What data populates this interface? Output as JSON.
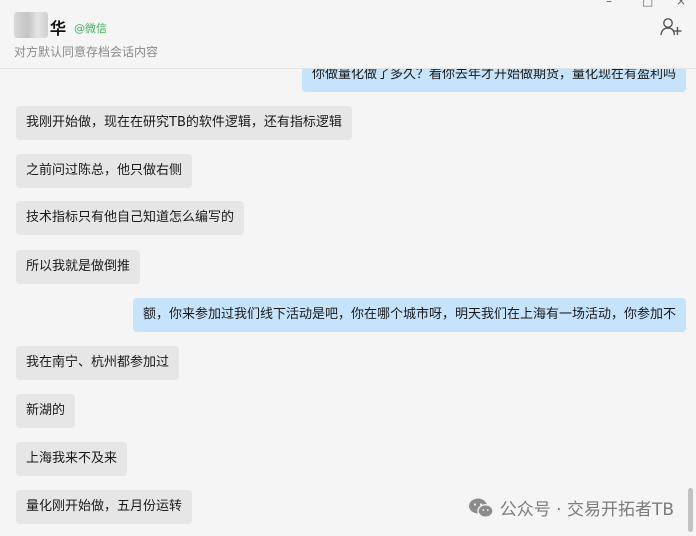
{
  "header": {
    "name_char": "华",
    "source": "@微信",
    "notice": "对方默认同意存档会话内容",
    "window_controls": {
      "minimize": "–",
      "maximize": "□",
      "close": "×"
    }
  },
  "messages": [
    {
      "side": "out",
      "text": "你做量化做了多久？看你去年才开始做期货，量化现在有盈利吗"
    },
    {
      "side": "in",
      "text": "我刚开始做，现在在研究TB的软件逻辑，还有指标逻辑"
    },
    {
      "side": "in",
      "text": "之前问过陈总，他只做右侧"
    },
    {
      "side": "in",
      "text": "技术指标只有他自己知道怎么编写的"
    },
    {
      "side": "in",
      "text": "所以我就是做倒推"
    },
    {
      "side": "out",
      "text": "额，你来参加过我们线下活动是吧，你在哪个城市呀，明天我们在上海有一场活动，你参加不"
    },
    {
      "side": "in",
      "text": "我在南宁、杭州都参加过"
    },
    {
      "side": "in",
      "text": "新湖的"
    },
    {
      "side": "in",
      "text": "上海我来不及来"
    },
    {
      "side": "in",
      "text": "量化刚开始做，五月份运转"
    }
  ],
  "watermark": {
    "text": "公众号 · 交易开拓者TB"
  },
  "colors": {
    "incoming_bubble": "#e6e6e6",
    "outgoing_bubble": "#c5e3fb",
    "verified_green": "#3fae5a"
  }
}
